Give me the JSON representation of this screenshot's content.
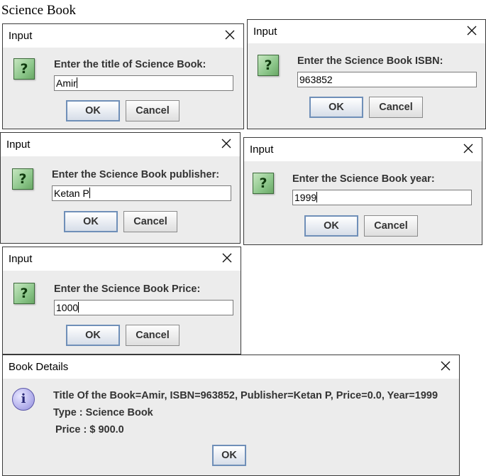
{
  "page_heading": "Science Book",
  "close_glyph": "×",
  "dialogs": [
    {
      "title": "Input",
      "prompt": "Enter the title of Science Book:",
      "value": "Amir",
      "ok": "OK",
      "cancel": "Cancel"
    },
    {
      "title": "Input",
      "prompt": "Enter the Science Book ISBN:",
      "value": "963852",
      "ok": "OK",
      "cancel": "Cancel"
    },
    {
      "title": "Input",
      "prompt": "Enter the Science Book publisher:",
      "value": "Ketan P",
      "ok": "OK",
      "cancel": "Cancel"
    },
    {
      "title": "Input",
      "prompt": "Enter the Science Book year:",
      "value": "1999",
      "ok": "OK",
      "cancel": "Cancel"
    },
    {
      "title": "Input",
      "prompt": "Enter the Science Book Price:",
      "value": "1000",
      "ok": "OK",
      "cancel": "Cancel"
    }
  ],
  "icons": {
    "question": "?",
    "info": "i"
  },
  "details": {
    "title": "Book Details",
    "lines": [
      "Title Of the Book=Amir, ISBN=963852, Publisher=Ketan P, Price=0.0, Year=1999",
      "Type : Science Book",
      "Price : $ 900.0"
    ],
    "ok": "OK"
  }
}
